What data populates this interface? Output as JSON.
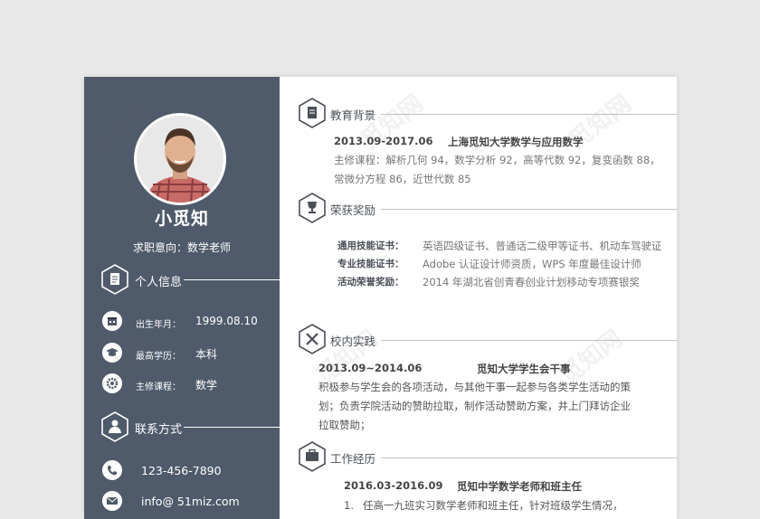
{
  "colors": {
    "sidebar": "#4f5a6a",
    "accent": "#4a4f58",
    "rule": "#bfc3c9"
  },
  "profile": {
    "name": "小觅知",
    "objective": "求职意向：数学老师"
  },
  "sidebar": {
    "personal_title": "个人信息",
    "personal_items": [
      {
        "icon": "calendar-icon",
        "label": "出生年月：",
        "value": "1999.08.10"
      },
      {
        "icon": "graduation-cap-icon",
        "label": "最高学历：",
        "value": "本科"
      },
      {
        "icon": "gear-icon",
        "label": "主修课程：",
        "value": "数学"
      }
    ],
    "contact_title": "联系方式",
    "contact_items": [
      {
        "icon": "phone-icon",
        "value": "123-456-7890"
      },
      {
        "icon": "mail-icon",
        "value": "info@ 51miz.com"
      }
    ]
  },
  "education": {
    "title": "教育背景",
    "date": "2013.09-2017.06",
    "school": "上海觅知大学数学与应用数学",
    "line1": "主修课程：解析几何 94，数学分析 92，高等代数 92，复变函数 88，",
    "line2": "常微分方程 86，近世代数 85"
  },
  "awards": {
    "title": "荣获奖励",
    "rows": [
      {
        "label": "通用技能证书：",
        "value": "英语四级证书、普通话二级甲等证书、机动车驾驶证"
      },
      {
        "label": "专业技能证书：",
        "value": "Adobe 认证设计师资质，WPS 年度最佳设计师"
      },
      {
        "label": "活动荣誉奖励：",
        "value": "2014 年湖北省创青春创业计划移动专项赛银奖"
      }
    ]
  },
  "campus": {
    "title": "校内实践",
    "date": "2013.09~2014.06",
    "role": "觅知大学学生会干事",
    "line1": "积极参与学生会的各项活动，与其他干事一起参与各类学生活动的策",
    "line2": "划；负责学院活动的赞助拉取，制作活动赞助方案，井上门拜访企业",
    "line3": "拉取赞助；"
  },
  "work": {
    "title": "工作经历",
    "date": "2016.03-2016.09",
    "role": "觅知中学数学老师和班主任",
    "item1_num": "1.",
    "item1": "任高一九班实习数学老师和班主任，针对班级学生情况，"
  },
  "watermark": "觅知网"
}
